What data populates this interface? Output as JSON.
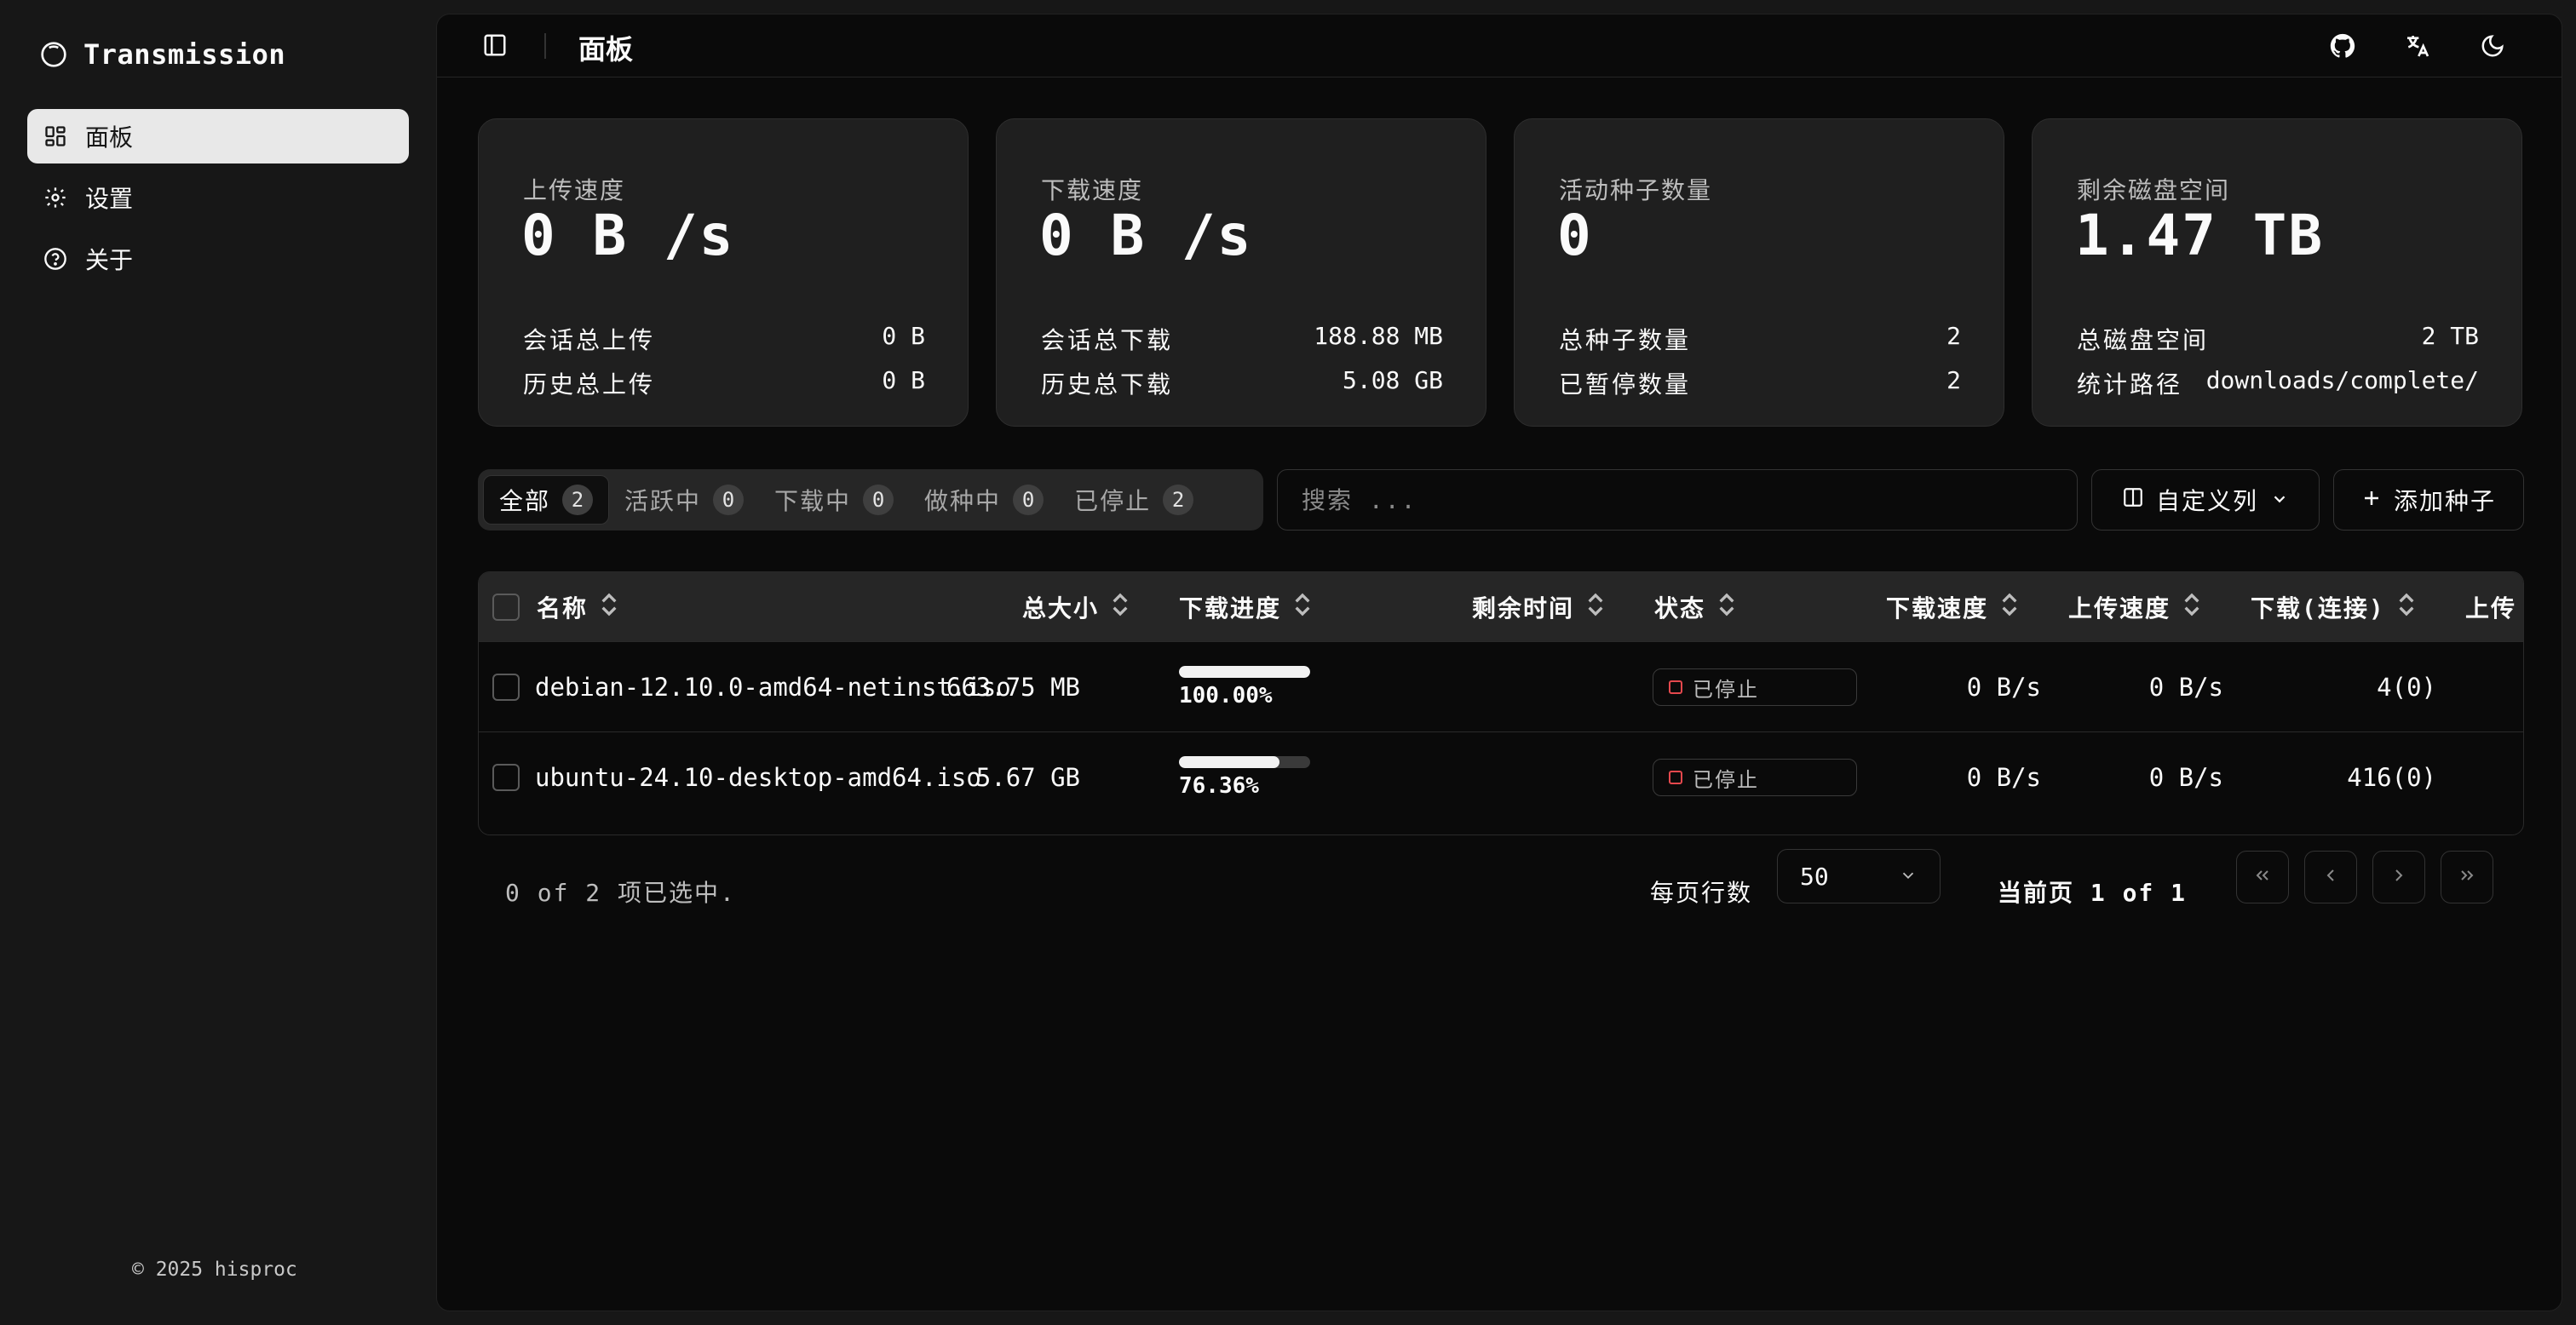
{
  "app": {
    "title": "Transmission",
    "footer": "© 2025 hisproc"
  },
  "sidebar": {
    "items": [
      {
        "label": "面板",
        "icon": "dashboard-icon",
        "active": true
      },
      {
        "label": "设置",
        "icon": "gear-icon",
        "active": false
      },
      {
        "label": "关于",
        "icon": "help-circle-icon",
        "active": false
      }
    ]
  },
  "header": {
    "title": "面板",
    "icons": [
      "github-icon",
      "translate-icon",
      "moon-icon"
    ]
  },
  "stats": [
    {
      "label": "上传速度",
      "value": "0 B /s",
      "rows": [
        {
          "label": "会话总上传",
          "value": "0 B"
        },
        {
          "label": "历史总上传",
          "value": "0 B"
        }
      ]
    },
    {
      "label": "下载速度",
      "value": "0 B /s",
      "rows": [
        {
          "label": "会话总下载",
          "value": "188.88 MB"
        },
        {
          "label": "历史总下载",
          "value": "5.08 GB"
        }
      ]
    },
    {
      "label": "活动种子数量",
      "value": "0",
      "rows": [
        {
          "label": "总种子数量",
          "value": "2"
        },
        {
          "label": "已暂停数量",
          "value": "2"
        }
      ]
    },
    {
      "label": "剩余磁盘空间",
      "value": "1.47 TB",
      "rows": [
        {
          "label": "总磁盘空间",
          "value": "2 TB"
        },
        {
          "label": "统计路径",
          "value": "downloads/complete/"
        }
      ]
    }
  ],
  "filters": {
    "tabs": [
      {
        "label": "全部",
        "count": "2",
        "active": true
      },
      {
        "label": "活跃中",
        "count": "0",
        "active": false
      },
      {
        "label": "下载中",
        "count": "0",
        "active": false
      },
      {
        "label": "做种中",
        "count": "0",
        "active": false
      },
      {
        "label": "已停止",
        "count": "2",
        "active": false
      }
    ],
    "search_placeholder": "搜索 ...",
    "columns_button": "自定义列",
    "add_button": "添加种子"
  },
  "table": {
    "headers": {
      "name": "名称",
      "size": "总大小",
      "progress": "下载进度",
      "eta": "剩余时间",
      "status": "状态",
      "down_speed": "下载速度",
      "up_speed": "上传速度",
      "peers": "下载(连接)",
      "upload": "上传"
    },
    "rows": [
      {
        "name": "debian-12.10.0-amd64-netinst.iso",
        "size": "663.75 MB",
        "progress": 1.0,
        "progress_text": "100.00%",
        "eta": "",
        "status": "已停止",
        "down_speed": "0 B/s",
        "up_speed": "0 B/s",
        "peers": "4(0)"
      },
      {
        "name": "ubuntu-24.10-desktop-amd64.iso",
        "size": "5.67 GB",
        "progress": 0.7636,
        "progress_text": "76.36%",
        "eta": "",
        "status": "已停止",
        "down_speed": "0 B/s",
        "up_speed": "0 B/s",
        "peers": "416(0)"
      }
    ]
  },
  "pagination": {
    "selection": "0 of 2 项已选中.",
    "rows_per_page_label": "每页行数",
    "rows_per_page": "50",
    "page_info": "当前页 1 of 1"
  },
  "colors": {
    "stopped": "#e5484d",
    "background": "#0a0a0a",
    "sidebar": "#171717"
  }
}
